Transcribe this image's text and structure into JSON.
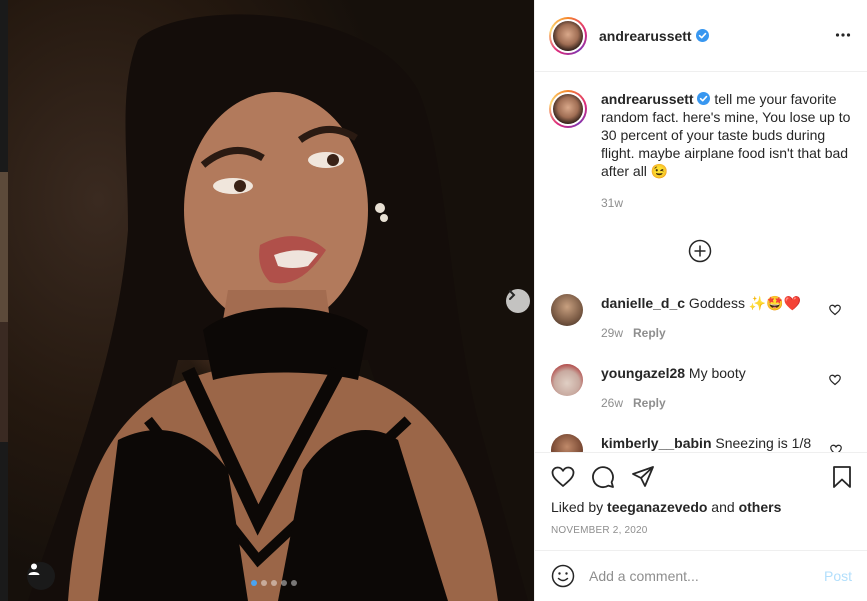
{
  "post": {
    "username": "andrearussett",
    "caption_text": " tell me your favorite random fact. here's mine, You lose up to 30 percent of your taste buds during flight. maybe airplane food isn't that bad after all 😉",
    "caption_time": "31w",
    "likes_prefix": "Liked by ",
    "likes_user": "teeganazevedo",
    "likes_and": " and ",
    "likes_others": "others",
    "date": "NOVEMBER 2, 2020"
  },
  "comments": [
    {
      "username": "danielle_d_c",
      "text": " Goddess ✨🤩❤️",
      "time": "29w",
      "reply": "Reply"
    },
    {
      "username": "youngazel28",
      "text": " My booty",
      "time": "26w",
      "reply": "Reply"
    },
    {
      "username": "kimberly__babin",
      "text": " Sneezing is 1/8",
      "time": "",
      "reply": ""
    }
  ],
  "add_comment": {
    "placeholder": "Add a comment...",
    "post_label": "Post"
  },
  "carousel": {
    "count": 5,
    "active_index": 0
  },
  "colors": {
    "accent": "#0095f6",
    "verified": "#3897f0",
    "post_disabled": "#b2dffc"
  },
  "icons": [
    "verified-badge-icon",
    "more-options-icon",
    "load-more-icon",
    "heart-icon",
    "comment-icon",
    "share-icon",
    "save-icon",
    "emoji-icon",
    "next-arrow-icon",
    "user-tag-icon"
  ]
}
